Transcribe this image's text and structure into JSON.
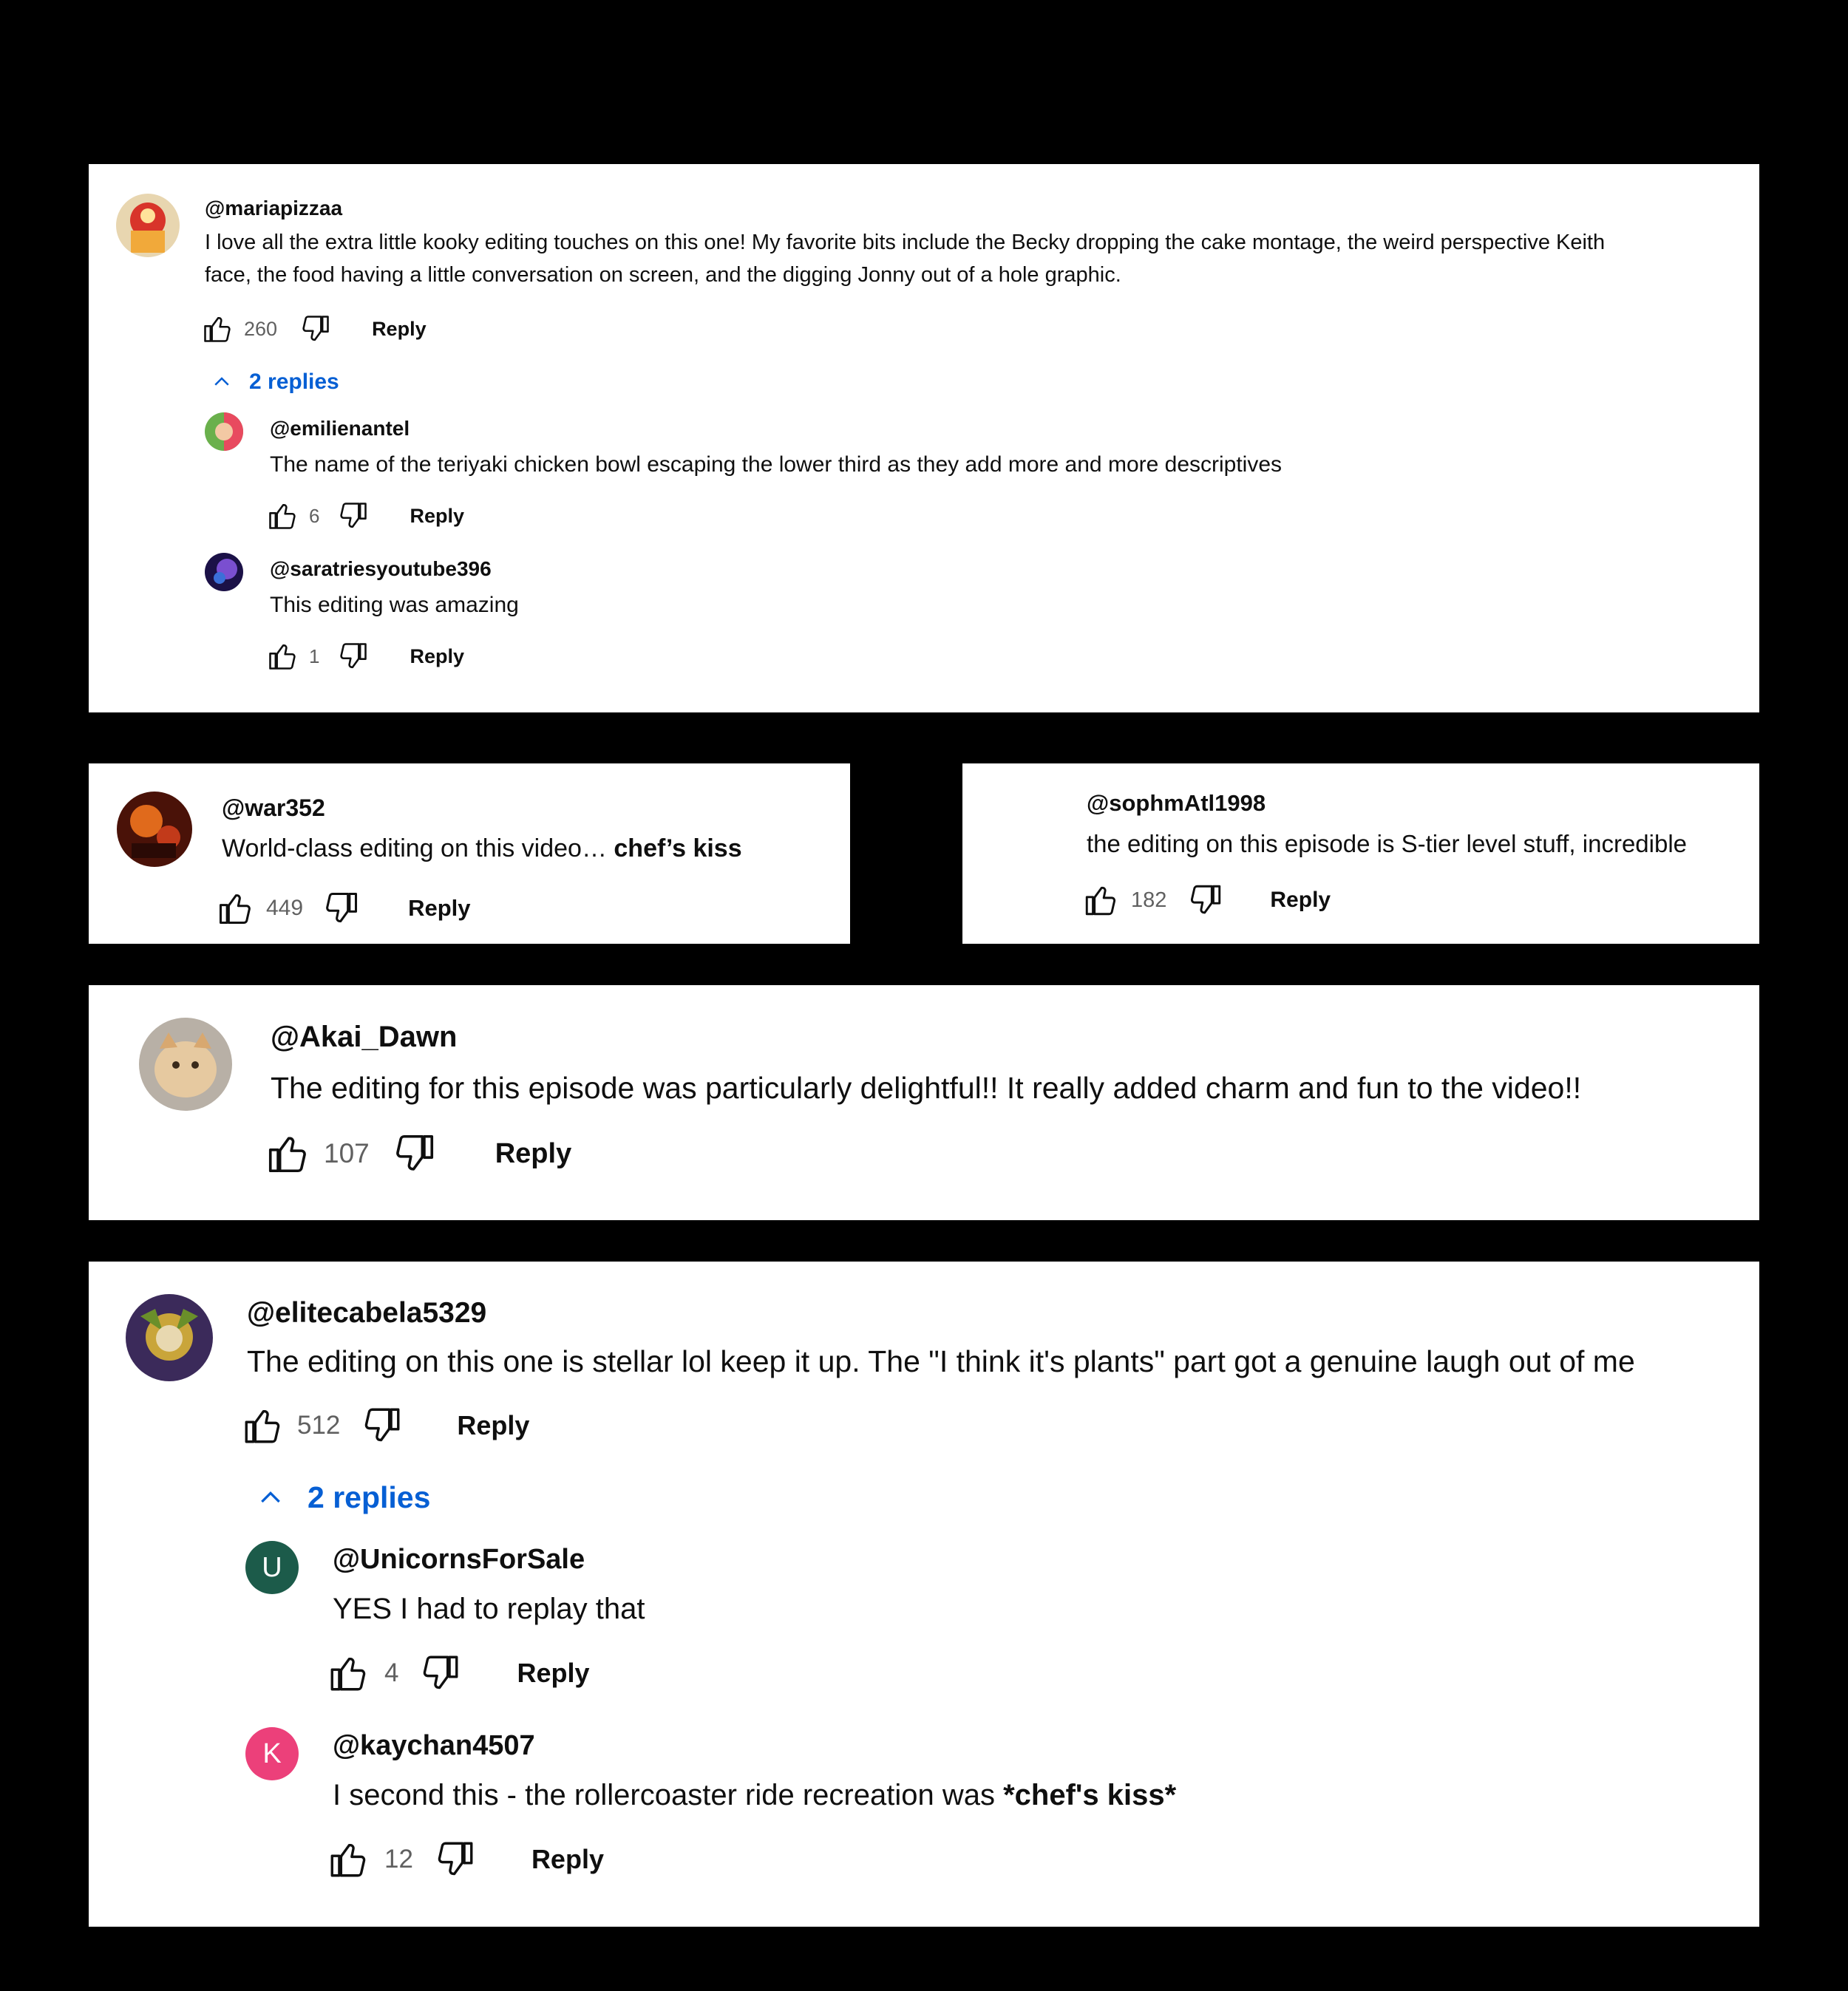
{
  "colors": {
    "link": "#065fd4",
    "count": "#606060",
    "unicorns_avatar": "#1c5b4a",
    "kaychan_avatar": "#ec407a"
  },
  "icons": {
    "like": "thumbs-up-icon",
    "dislike": "thumbs-down-icon",
    "expand": "chevron-up-icon"
  },
  "thread1": {
    "handle": "@mariapizzaa",
    "line1": "I love all the extra little kooky editing touches on this one!  My favorite bits include the Becky dropping the cake montage, the weird perspective Keith",
    "line2": "face, the food having a little conversation on screen, and the digging Jonny out of a hole graphic.",
    "likes": "260",
    "reply": "Reply",
    "replies_label": "2 replies",
    "replies": [
      {
        "handle": "@emilienantel",
        "text": "The name of the teriyaki chicken bowl escaping the lower third as they add more and more descriptives",
        "likes": "6",
        "reply": "Reply"
      },
      {
        "handle": "@saratriesyoutube396",
        "text": "This editing was amazing",
        "likes": "1",
        "reply": "Reply"
      }
    ]
  },
  "war": {
    "handle": "@war352",
    "text_plain": "World-class editing on this video… ",
    "text_bold": "chef’s kiss",
    "likes": "449",
    "reply": "Reply"
  },
  "sophm": {
    "handle": "@sophmAtl1998",
    "text": "the editing on this episode is S-tier level stuff, incredible",
    "likes": "182",
    "reply": "Reply"
  },
  "akai": {
    "handle": "@Akai_Dawn",
    "text": "The editing for this episode was particularly delightful!! It really added charm and fun to the video!!",
    "likes": "107",
    "reply": "Reply"
  },
  "elite": {
    "handle": "@elitecabela5329",
    "text": "The editing on this one is stellar lol keep it up. The \"I think it's plants\" part got a genuine laugh out of me",
    "likes": "512",
    "reply": "Reply",
    "replies_label": "2 replies",
    "replies": [
      {
        "handle": "@UnicornsForSale",
        "avatar_letter": "U",
        "text_plain": "YES I had to replay that",
        "likes": "4",
        "reply": "Reply"
      },
      {
        "handle": "@kaychan4507",
        "avatar_letter": "K",
        "text_plain": "I second this - the rollercoaster ride recreation was ",
        "text_bold": "*chef's kiss*",
        "likes": "12",
        "reply": "Reply"
      }
    ]
  }
}
